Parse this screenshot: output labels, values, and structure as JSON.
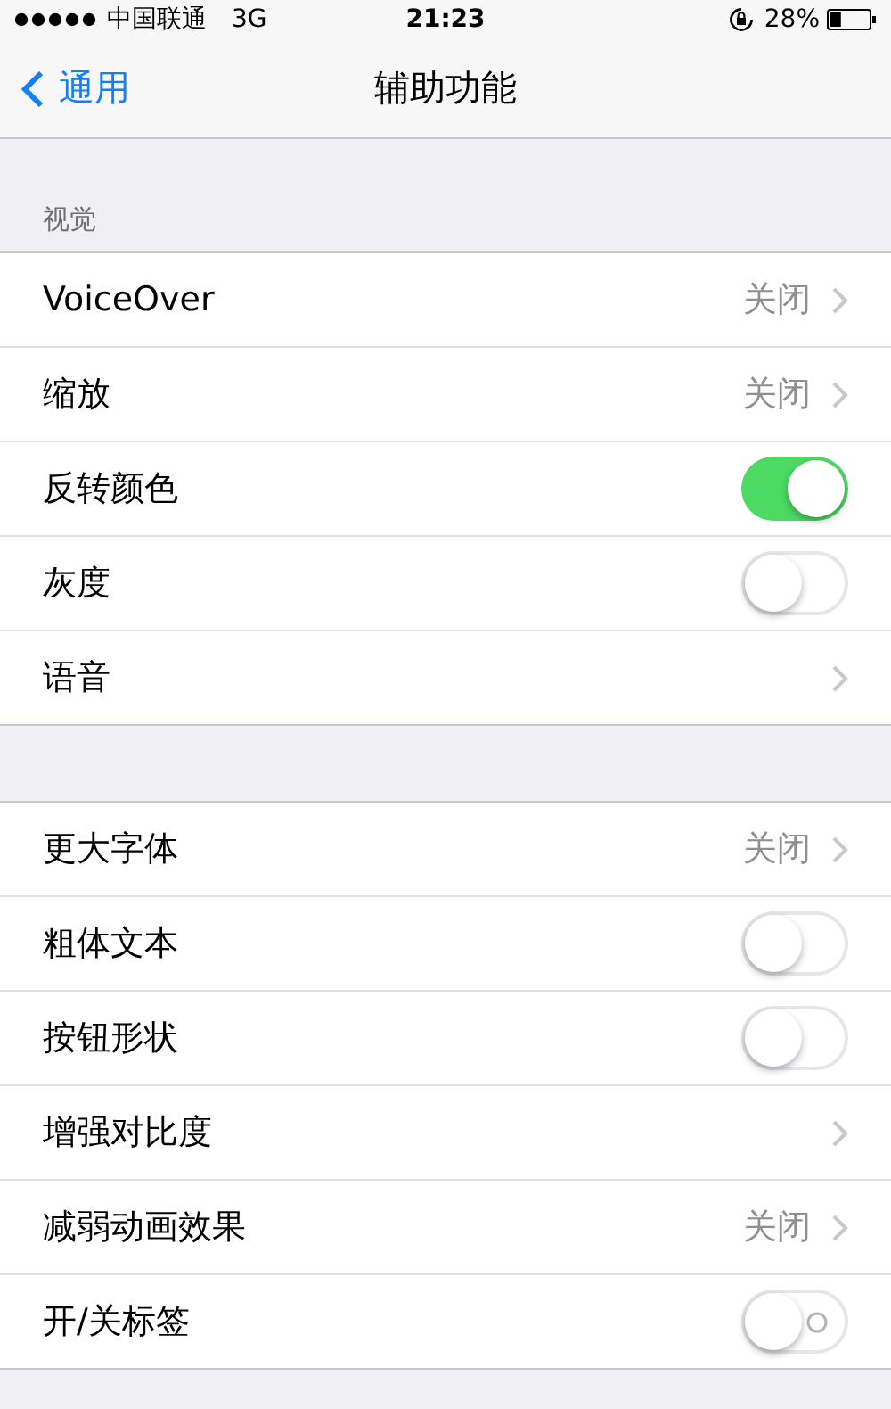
{
  "status_bar": {
    "carrier": "中国联通",
    "network": "3G",
    "time": "21:23",
    "battery": "28%"
  },
  "nav": {
    "back": "通用",
    "title": "辅助功能"
  },
  "groups": [
    {
      "header": "视觉",
      "rows": [
        {
          "kind": "link",
          "label": "VoiceOver",
          "value": "关闭"
        },
        {
          "kind": "link",
          "label": "缩放",
          "value": "关闭"
        },
        {
          "kind": "toggle",
          "label": "反转颜色",
          "on": true,
          "off_label": false
        },
        {
          "kind": "toggle",
          "label": "灰度",
          "on": false,
          "off_label": false
        },
        {
          "kind": "link",
          "label": "语音"
        }
      ]
    },
    {
      "rows": [
        {
          "kind": "link",
          "label": "更大字体",
          "value": "关闭"
        },
        {
          "kind": "toggle",
          "label": "粗体文本",
          "on": false,
          "off_label": false
        },
        {
          "kind": "toggle",
          "label": "按钮形状",
          "on": false,
          "off_label": false
        },
        {
          "kind": "link",
          "label": "增强对比度"
        },
        {
          "kind": "link",
          "label": "减弱动画效果",
          "value": "关闭"
        },
        {
          "kind": "toggle",
          "label": "开/关标签",
          "on": false,
          "off_label": true
        }
      ]
    }
  ]
}
